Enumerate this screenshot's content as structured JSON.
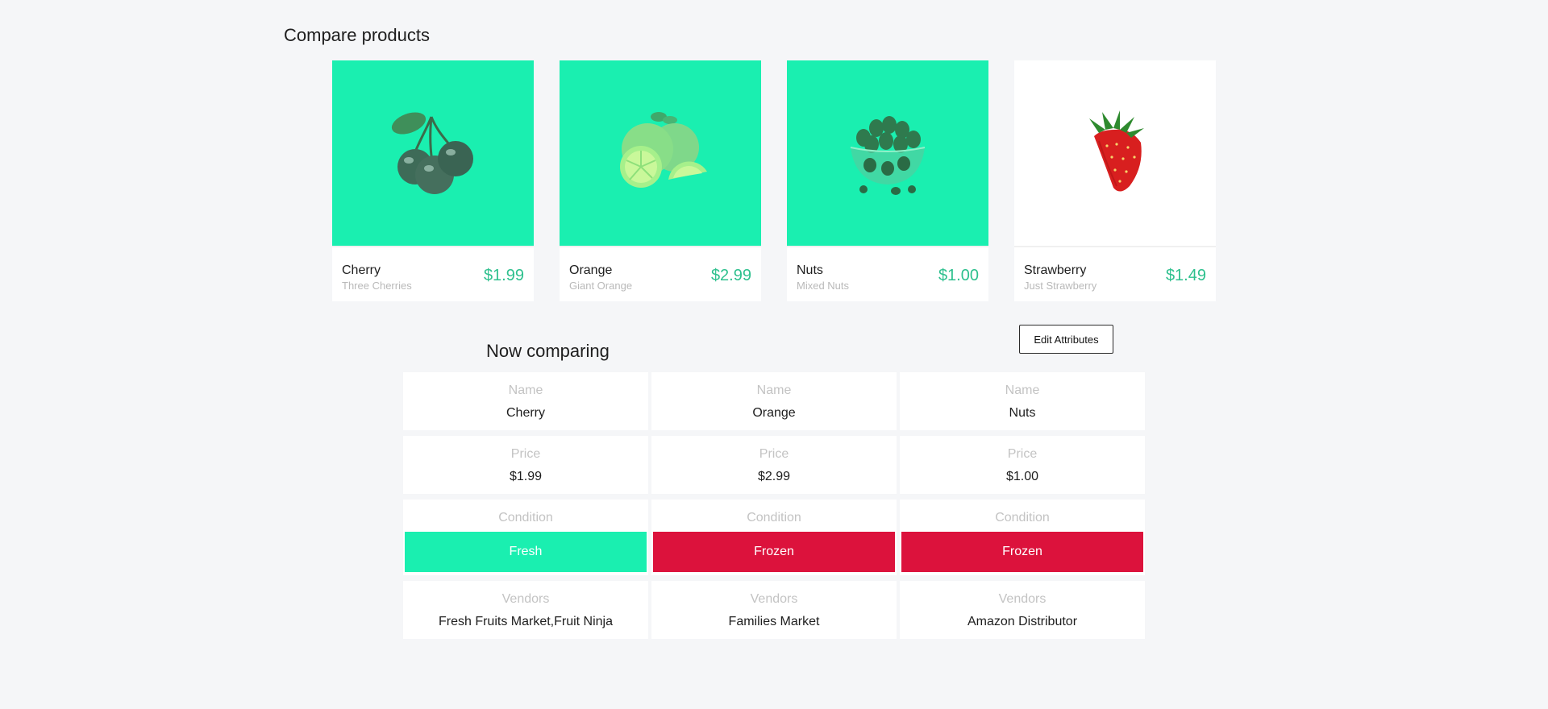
{
  "page": {
    "title": "Compare products"
  },
  "colors": {
    "accent": "#1aefb0",
    "price": "#2ec08e",
    "frozen": "#dc123c",
    "background": "#f5f6f8"
  },
  "products": [
    {
      "name": "Cherry",
      "subtitle": "Three Cherries",
      "price": "$1.99",
      "image": "cherry-image",
      "selected": true
    },
    {
      "name": "Orange",
      "subtitle": "Giant Orange",
      "price": "$2.99",
      "image": "orange-image",
      "selected": true
    },
    {
      "name": "Nuts",
      "subtitle": "Mixed Nuts",
      "price": "$1.00",
      "image": "nuts-bowl-image",
      "selected": true
    },
    {
      "name": "Strawberry",
      "subtitle": "Just Strawberry",
      "price": "$1.49",
      "image": "strawberry-image",
      "selected": false
    }
  ],
  "comparison": {
    "title": "Now comparing",
    "edit_button_label": "Edit Attributes",
    "labels": {
      "name": "Name",
      "price": "Price",
      "condition": "Condition",
      "vendors": "Vendors"
    },
    "columns": [
      {
        "name": "Cherry",
        "price": "$1.99",
        "condition": "Fresh",
        "condition_color": "#1aefb0",
        "vendors": "Fresh Fruits Market,Fruit Ninja"
      },
      {
        "name": "Orange",
        "price": "$2.99",
        "condition": "Frozen",
        "condition_color": "#dc123c",
        "vendors": "Families Market"
      },
      {
        "name": "Nuts",
        "price": "$1.00",
        "condition": "Frozen",
        "condition_color": "#dc123c",
        "vendors": "Amazon Distributor"
      }
    ]
  }
}
